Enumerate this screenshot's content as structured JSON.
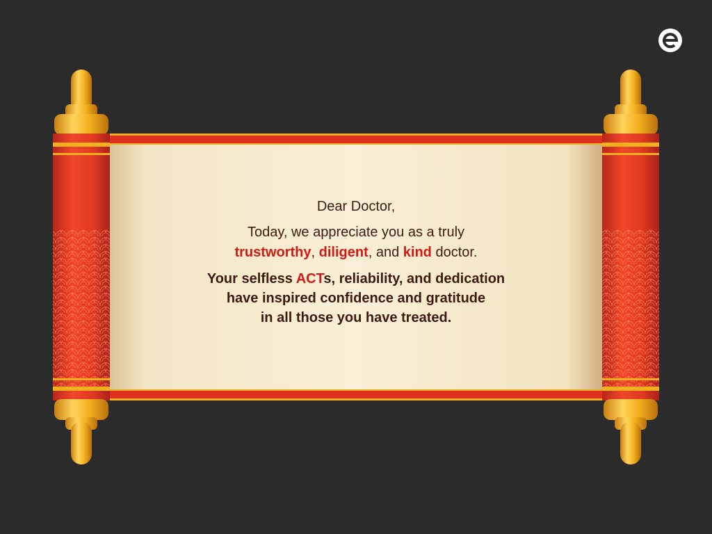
{
  "colors": {
    "background": "#2b2b2b",
    "parchment": "#f5ead0",
    "scroll_red": "#e23a22",
    "gold": "#f2b01e",
    "highlight_red": "#d11a14",
    "text_dark": "#3d1a10"
  },
  "brand": {
    "icon": "brand-logo-icon"
  },
  "letter": {
    "greeting": "Dear Doctor,",
    "line1": "Today, we appreciate you as a truly",
    "quality1": "trustworthy",
    "sep1": ", ",
    "quality2": "diligent",
    "sep2": ", and ",
    "quality3": "kind",
    "tail": " doctor.",
    "tribute_start": "Your selfless ",
    "tribute_acts": "ACT",
    "tribute_after_acts": "s, reliability, and dedication",
    "tribute_line2": "have inspired confidence and gratitude",
    "tribute_line3": "in all those you have treated."
  }
}
